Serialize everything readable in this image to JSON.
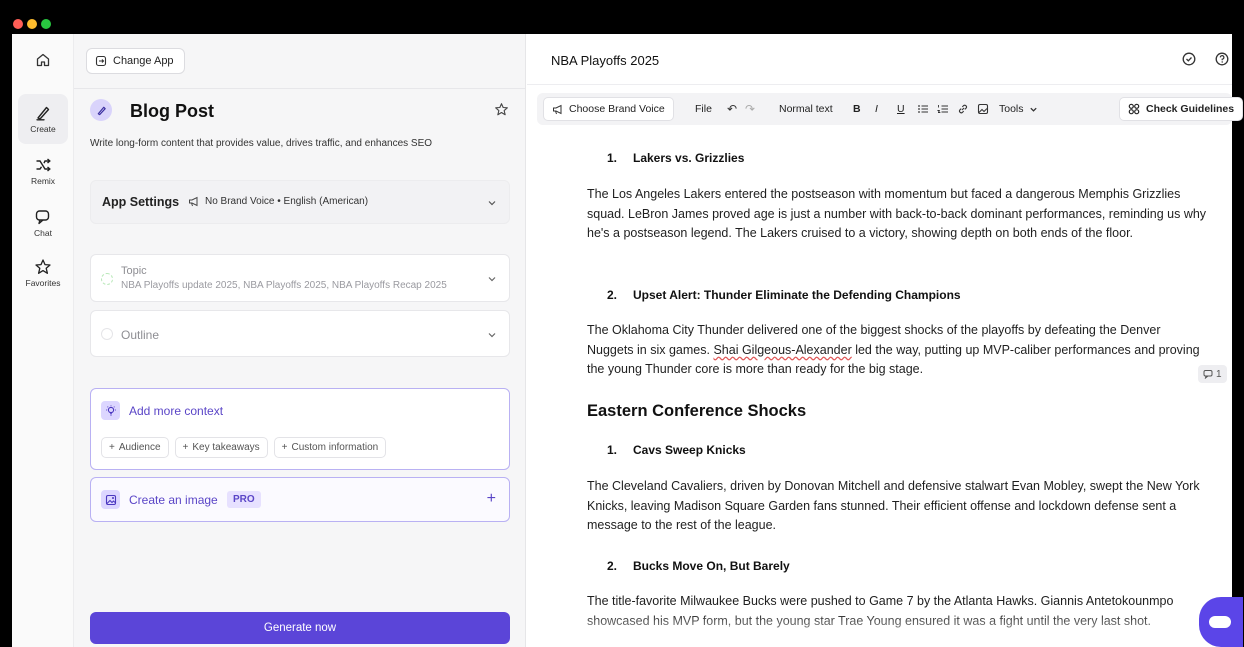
{
  "sidebar": {
    "items": [
      {
        "label": "Create",
        "icon": "pen-icon"
      },
      {
        "label": "Remix",
        "icon": "shuffle-icon"
      },
      {
        "label": "Chat",
        "icon": "chat-icon"
      },
      {
        "label": "Favorites",
        "icon": "star-icon"
      }
    ]
  },
  "panel": {
    "change_app": "Change App",
    "app_title": "Blog Post",
    "app_description": "Write long-form content that provides value, drives traffic, and enhances SEO",
    "settings": {
      "label": "App Settings",
      "value": "No Brand Voice • English (American)"
    },
    "topic": {
      "label": "Topic",
      "value": "NBA Playoffs update 2025, NBA Playoffs 2025, NBA Playoffs Recap 2025"
    },
    "outline": {
      "label": "Outline"
    },
    "context": {
      "title": "Add more context",
      "chips": [
        "Audience",
        "Key takeaways",
        "Custom information"
      ]
    },
    "image": {
      "title": "Create an image",
      "badge": "PRO"
    },
    "generate_label": "Generate now"
  },
  "editor": {
    "title": "NBA Playoffs 2025",
    "toolbar": {
      "brand_voice": "Choose Brand Voice",
      "file": "File",
      "text_style": "Normal text",
      "bold": "B",
      "italic": "I",
      "underline": "U",
      "tools": "Tools",
      "check_guidelines": "Check Guidelines"
    },
    "comment_count": "1",
    "content": {
      "item1": {
        "num": "1.",
        "title": "Lakers vs. Grizzlies"
      },
      "para1": "The Los Angeles Lakers entered the postseason with momentum but faced a dangerous Memphis Grizzlies squad. LeBron James proved age is just a number with back-to-back dominant performances, reminding us why he's a postseason legend. The Lakers cruised to a victory, showing depth on both ends of the floor.",
      "item2": {
        "num": "2.",
        "title": "Upset Alert: Thunder Eliminate the Defending Champions"
      },
      "para2_before": "The Oklahoma City Thunder delivered one of the biggest shocks of the playoffs by defeating the Denver Nuggets in six games. ",
      "para2_name": "Shai Gilgeous-Alexander",
      "para2_after": " led the way, putting up MVP-caliber performances and proving the young Thunder core is more than ready for the big stage.",
      "heading": "Eastern Conference Shocks",
      "item3": {
        "num": "1.",
        "title": "Cavs Sweep Knicks"
      },
      "para3": "The Cleveland Cavaliers, driven by Donovan Mitchell and defensive stalwart Evan Mobley, swept the New York Knicks, leaving Madison Square Garden fans stunned. Their efficient offense and lockdown defense sent a message to the rest of the league.",
      "item4": {
        "num": "2.",
        "title": "Bucks Move On, But Barely"
      },
      "para4": "The title-favorite Milwaukee Bucks were pushed to Game 7 by the Atlanta Hawks. Giannis Antetokounmpo showcased his MVP form, but the young star Trae Young ensured it was a fight until the very last shot."
    }
  },
  "colors": {
    "accent": "#5b45d8",
    "accent_soft": "#dcd6ff",
    "accent_text": "#5a45c7"
  }
}
